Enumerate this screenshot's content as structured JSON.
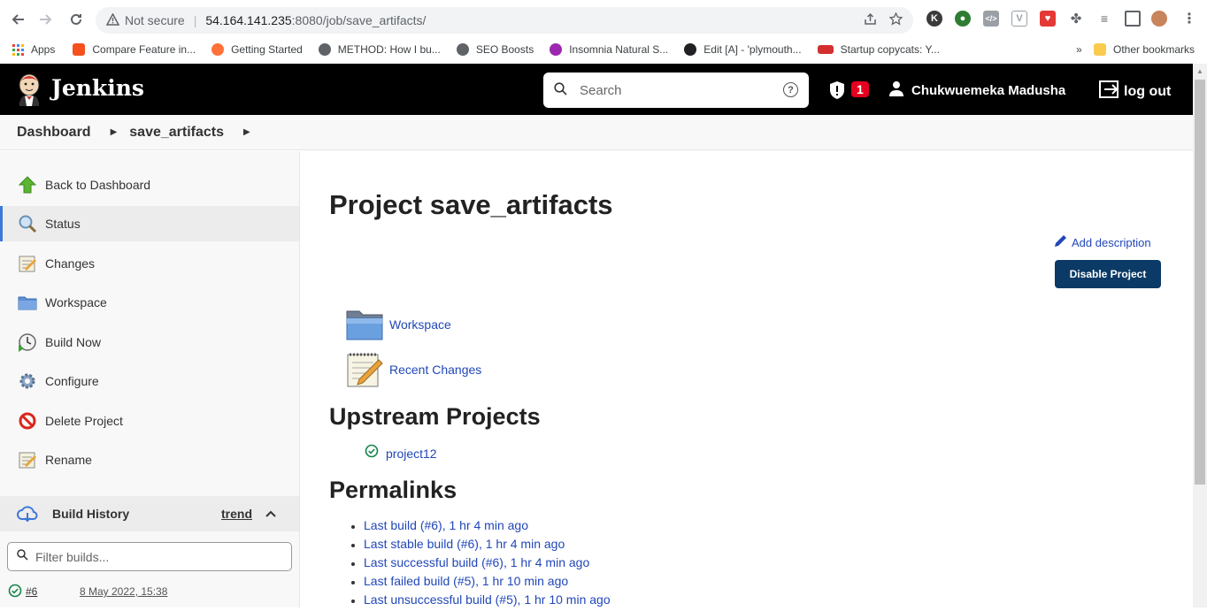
{
  "browser": {
    "security_label": "Not secure",
    "url_host": "54.164.141.235",
    "url_path": ":8080/job/save_artifacts/",
    "bookmarks": [
      {
        "label": "Apps",
        "color": "#e8453c"
      },
      {
        "label": "Compare Feature in...",
        "color": "#f4511e"
      },
      {
        "label": "Getting Started",
        "color": "#ff7139"
      },
      {
        "label": "METHOD: How I bu...",
        "color": "#5f6368"
      },
      {
        "label": "SEO Boosts",
        "color": "#5f6368"
      },
      {
        "label": "Insomnia Natural S...",
        "color": "#9c27b0"
      },
      {
        "label": "Edit [A] - 'plymouth...",
        "color": "#202124"
      },
      {
        "label": "Startup copycats: Y...",
        "color": "#d32f2f"
      }
    ],
    "more_bookmarks": "»",
    "other_bookmarks": "Other bookmarks"
  },
  "header": {
    "title": "Jenkins",
    "search_placeholder": "Search",
    "search_help": "?",
    "alert_count": "1",
    "user_name": "Chukwuemeka Madusha",
    "logout_label": "log out"
  },
  "breadcrumbs": [
    "Dashboard",
    "save_artifacts"
  ],
  "sidebar": {
    "tasks": [
      {
        "label": "Back to Dashboard",
        "icon": "up-arrow-icon"
      },
      {
        "label": "Status",
        "icon": "magnifier-icon",
        "active": true
      },
      {
        "label": "Changes",
        "icon": "notepad-icon"
      },
      {
        "label": "Workspace",
        "icon": "folder-icon"
      },
      {
        "label": "Build Now",
        "icon": "clock-play-icon"
      },
      {
        "label": "Configure",
        "icon": "gear-icon"
      },
      {
        "label": "Delete Project",
        "icon": "no-entry-icon"
      },
      {
        "label": "Rename",
        "icon": "notepad-icon"
      }
    ],
    "build_history": {
      "label": "Build History",
      "trend_label": "trend",
      "filter_placeholder": "Filter builds...",
      "builds": [
        {
          "number": "#6",
          "date": "8 May 2022, 15:38",
          "status": "success"
        }
      ]
    }
  },
  "main": {
    "title": "Project save_artifacts",
    "add_description": "Add description",
    "disable_button": "Disable Project",
    "links": [
      {
        "label": "Workspace",
        "icon": "folder-icon"
      },
      {
        "label": "Recent Changes",
        "icon": "notepad-icon"
      }
    ],
    "upstream_title": "Upstream Projects",
    "upstream": [
      {
        "label": "project12",
        "status": "success"
      }
    ],
    "permalinks_title": "Permalinks",
    "permalinks": [
      "Last build (#6), 1 hr 4 min ago",
      "Last stable build (#6), 1 hr 4 min ago",
      "Last successful build (#6), 1 hr 4 min ago",
      "Last failed build (#5), 1 hr 10 min ago",
      "Last unsuccessful build (#5), 1 hr 10 min ago"
    ]
  },
  "colors": {
    "link": "#2147b8",
    "header_bg": "#000000",
    "button_bg": "#0b3a66",
    "success": "#138347",
    "alert": "#e6001f"
  }
}
